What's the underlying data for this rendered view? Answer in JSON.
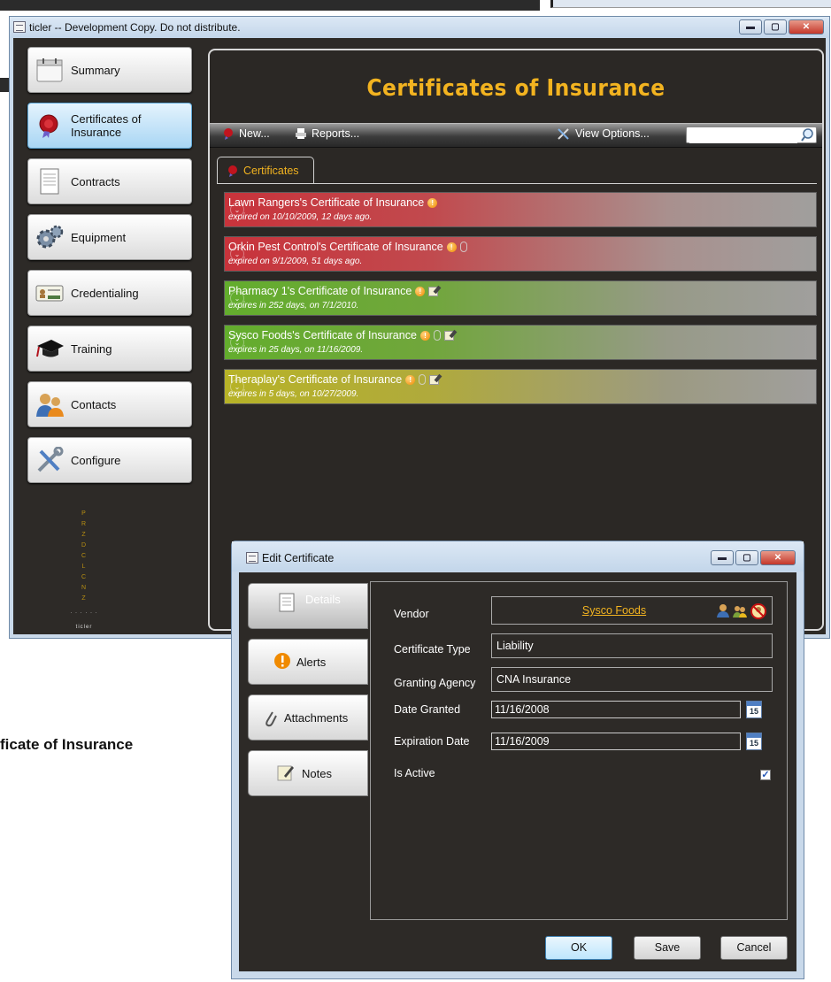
{
  "background": {
    "fragment_text": "ficate of Insurance"
  },
  "main_window": {
    "title": "ticler -- Development Copy.  Do not distribute.",
    "buttons": {
      "minimize": "▬",
      "maximize": "▢",
      "close": "✕"
    }
  },
  "nav": {
    "items": [
      {
        "label": "Summary",
        "icon": "calendar-icon"
      },
      {
        "label": "Certificates of Insurance",
        "icon": "seal-icon"
      },
      {
        "label": "Contracts",
        "icon": "document-icon"
      },
      {
        "label": "Equipment",
        "icon": "gear-icon"
      },
      {
        "label": "Credentialing",
        "icon": "id-card-icon"
      },
      {
        "label": "Training",
        "icon": "graduation-cap-icon"
      },
      {
        "label": "Contacts",
        "icon": "people-icon"
      },
      {
        "label": "Configure",
        "icon": "tools-icon"
      }
    ],
    "active": "Certificates of Insurance",
    "logo_text": "ticler"
  },
  "content": {
    "heading": "Certificates of Insurance",
    "toolbar": {
      "new_label": "New...",
      "reports_label": "Reports...",
      "view_options_label": "View Options...",
      "search_value": ""
    },
    "tab_label": "Certificates",
    "certificates": [
      {
        "title": "Lawn Rangers's Certificate of Insurance",
        "subtitle": "expired on 10/10/2009, 12 days ago.",
        "status": "red"
      },
      {
        "title": "Orkin Pest Control's Certificate of Insurance",
        "subtitle": "expired on 9/1/2009, 51 days ago.",
        "status": "red"
      },
      {
        "title": "Pharmacy 1's Certificate of Insurance",
        "subtitle": "expires in 252 days, on 7/1/2010.",
        "status": "green"
      },
      {
        "title": "Sysco Foods's Certificate of Insurance",
        "subtitle": "expires in 25 days, on 11/16/2009.",
        "status": "green"
      },
      {
        "title": "Theraplay's Certificate of Insurance",
        "subtitle": "expires in 5 days, on 10/27/2009.",
        "status": "yellow"
      }
    ]
  },
  "dialog": {
    "title": "Edit Certificate",
    "tabs": [
      {
        "label": "Details"
      },
      {
        "label": "Alerts"
      },
      {
        "label": "Attachments"
      },
      {
        "label": "Notes"
      }
    ],
    "fields": {
      "vendor_label": "Vendor",
      "vendor_value": "Sysco Foods",
      "type_label": "Certificate Type",
      "type_value": "Liability",
      "agency_label": "Granting Agency",
      "agency_value": "CNA Insurance",
      "granted_label": "Date Granted",
      "granted_value": "11/16/2008",
      "expiration_label": "Expiration Date",
      "expiration_value": "11/16/2009",
      "active_label": "Is Active",
      "active_checked": true,
      "calendar_day": "15"
    },
    "buttons": {
      "ok": "OK",
      "save": "Save",
      "cancel": "Cancel"
    }
  },
  "colors": {
    "accent": "#f2b320",
    "dark_bg": "#2d2a27",
    "expired": "#c8333b",
    "ok": "#63ad2d",
    "warning": "#b7b327"
  }
}
